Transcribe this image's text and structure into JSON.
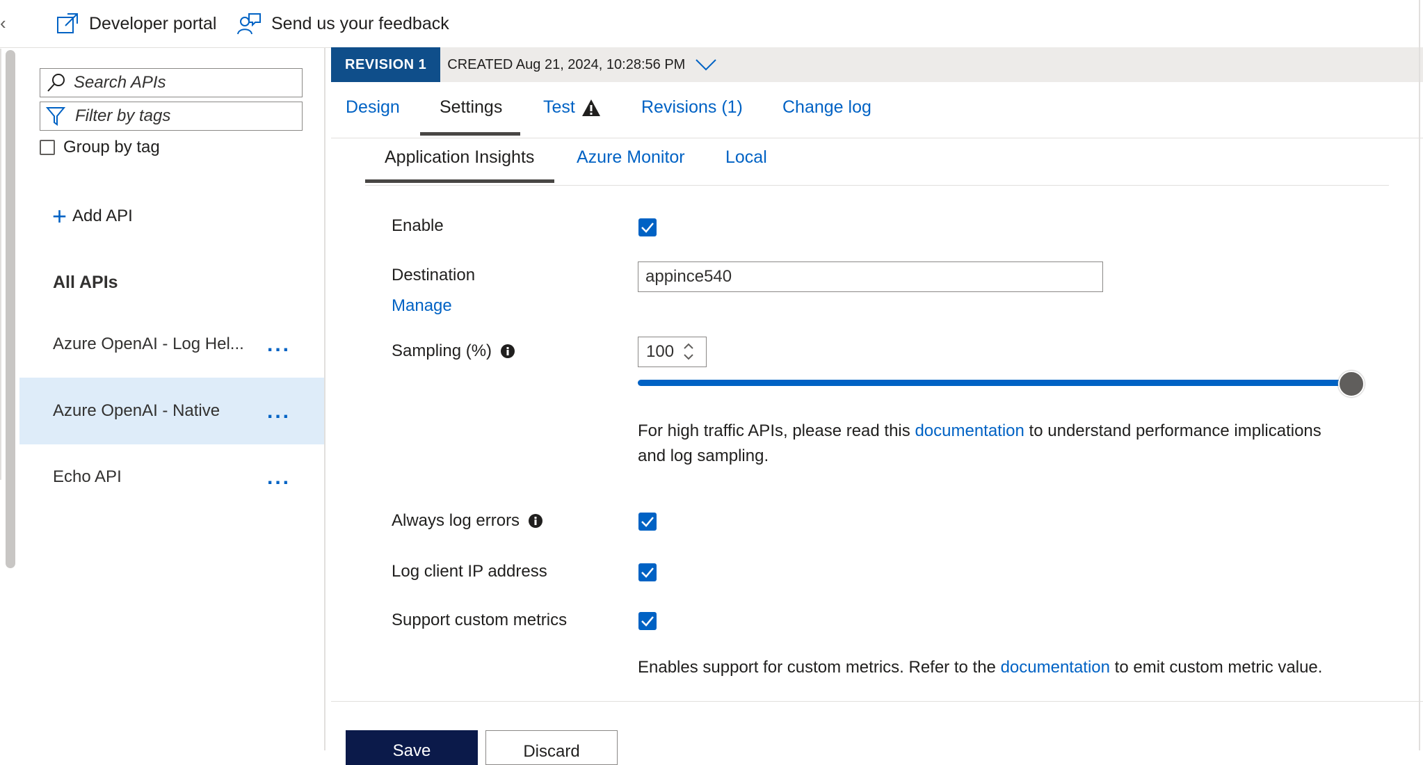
{
  "topbar": {
    "collapse_glyph": "‹",
    "developer_portal": "Developer portal",
    "feedback": "Send us your feedback"
  },
  "sidebar": {
    "search_placeholder": "Search APIs",
    "filter_placeholder": "Filter by tags",
    "group_by_tag": "Group by tag",
    "add_api": "Add API",
    "all_apis": "All APIs",
    "apis": [
      {
        "name": "Azure OpenAI - Log Hel...",
        "selected": false
      },
      {
        "name": "Azure OpenAI - Native",
        "selected": true
      },
      {
        "name": "Echo API",
        "selected": false
      }
    ],
    "more_glyph": "..."
  },
  "revision": {
    "badge": "REVISION 1",
    "created": "CREATED Aug 21, 2024, 10:28:56 PM"
  },
  "tabs": {
    "design": "Design",
    "settings": "Settings",
    "test": "Test",
    "revisions": "Revisions (1)",
    "changelog": "Change log",
    "active": "Settings"
  },
  "subtabs": {
    "app_insights": "Application Insights",
    "azure_monitor": "Azure Monitor",
    "local": "Local",
    "active": "Application Insights"
  },
  "form": {
    "enable_label": "Enable",
    "enable_checked": true,
    "destination_label": "Destination",
    "destination_value": "appince540",
    "manage_link": "Manage",
    "sampling_label": "Sampling (%)",
    "sampling_value": "100",
    "sampling_fraction": 1.0,
    "sampling_note_pre": "For high traffic APIs, please read this ",
    "sampling_note_link": "documentation",
    "sampling_note_post": " to understand performance implications",
    "sampling_note_line2": "and log sampling.",
    "always_log_errors_label": "Always log errors",
    "always_log_errors_checked": true,
    "log_client_ip_label": "Log client IP address",
    "log_client_ip_checked": true,
    "custom_metrics_label": "Support custom metrics",
    "custom_metrics_checked": true,
    "custom_note_pre": "Enables support for custom metrics. Refer to the ",
    "custom_note_link": "documentation",
    "custom_note_post": " to emit custom metric value."
  },
  "footer": {
    "save": "Save",
    "discard": "Discard"
  },
  "colors": {
    "accent": "#0062c4",
    "revision_badge": "#0f4e8a",
    "save_button": "#0b1a4a",
    "selected_row": "#deecf9"
  }
}
